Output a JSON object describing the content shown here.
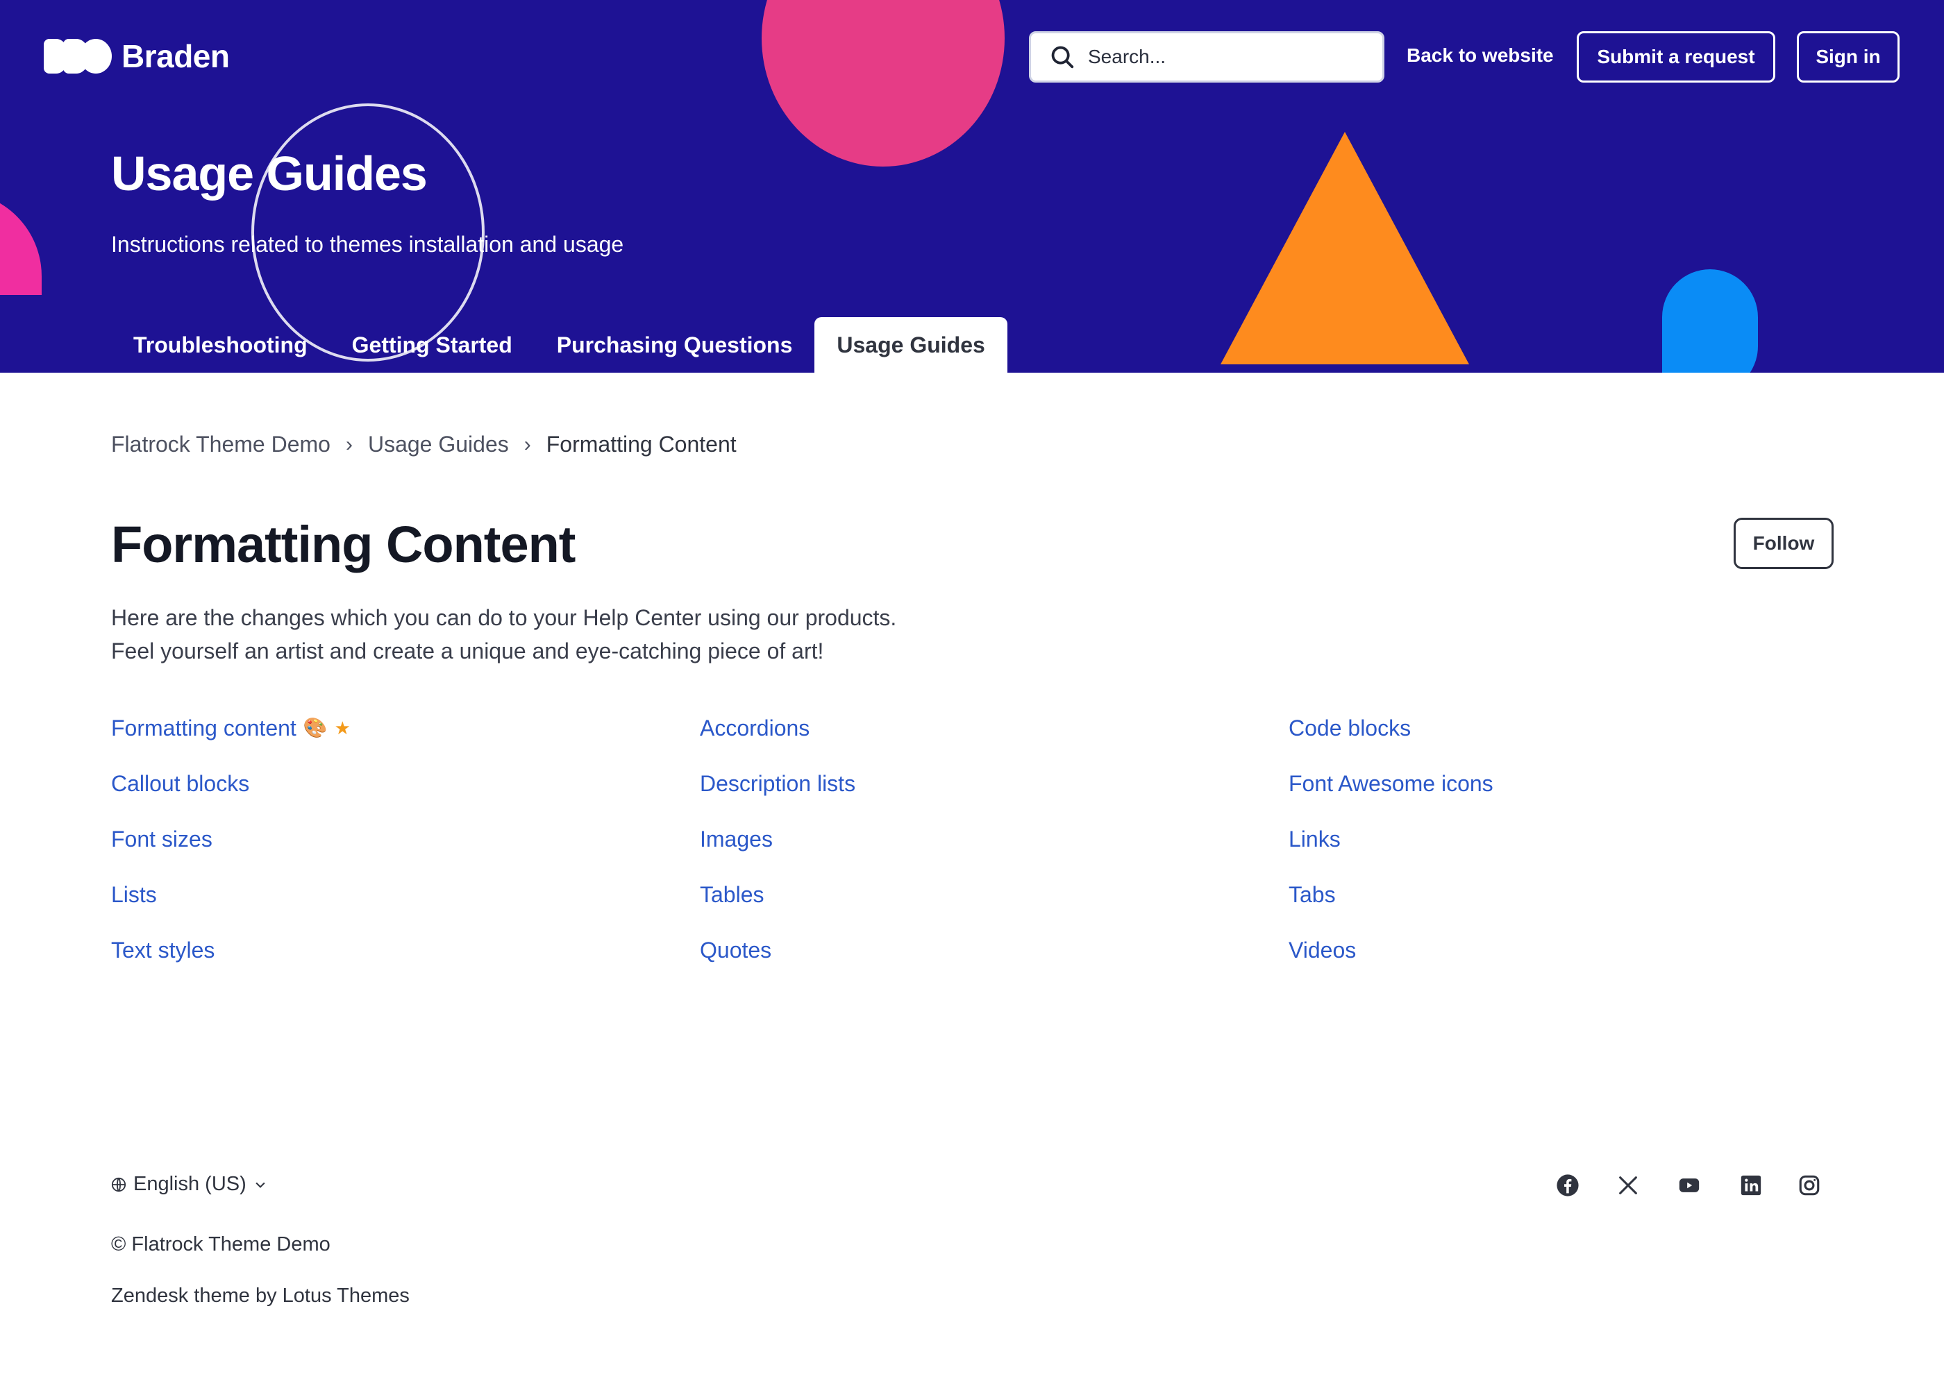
{
  "brand": {
    "name": "Braden"
  },
  "header": {
    "search_placeholder": "Search...",
    "back_to_website": "Back to website",
    "submit_request": "Submit a request",
    "sign_in": "Sign in"
  },
  "hero": {
    "title": "Usage Guides",
    "subtitle": "Instructions related to themes installation and usage",
    "tabs": [
      {
        "label": "Troubleshooting",
        "active": false
      },
      {
        "label": "Getting Started",
        "active": false
      },
      {
        "label": "Purchasing Questions",
        "active": false
      },
      {
        "label": "Usage Guides",
        "active": true
      }
    ],
    "colors": {
      "background": "#1e1294",
      "pink": "#e63c86",
      "orange": "#fe8b1e",
      "blue": "#0a8cf6",
      "magenta": "#f02ea0"
    }
  },
  "breadcrumb": {
    "items": [
      "Flatrock Theme Demo",
      "Usage Guides",
      "Formatting Content"
    ],
    "separator": "›"
  },
  "section": {
    "title": "Formatting Content",
    "follow_label": "Follow",
    "description_line1": "Here are the changes which you can do to your Help Center using our products.",
    "description_line2": "Feel yourself an artist and create a unique and eye-catching piece of art!"
  },
  "articles": [
    {
      "label": "Formatting content",
      "emoji": "🎨",
      "star": "★"
    },
    {
      "label": "Accordions"
    },
    {
      "label": "Code blocks"
    },
    {
      "label": "Callout blocks"
    },
    {
      "label": "Description lists"
    },
    {
      "label": "Font Awesome icons"
    },
    {
      "label": "Font sizes"
    },
    {
      "label": "Images"
    },
    {
      "label": "Links"
    },
    {
      "label": "Lists"
    },
    {
      "label": "Tables"
    },
    {
      "label": "Tabs"
    },
    {
      "label": "Text styles"
    },
    {
      "label": "Quotes"
    },
    {
      "label": "Videos"
    }
  ],
  "footer": {
    "language": "English (US)",
    "copyright": "© Flatrock Theme Demo",
    "credit": "Zendesk theme by Lotus Themes",
    "socials": [
      "facebook-icon",
      "x-icon",
      "youtube-icon",
      "linkedin-icon",
      "instagram-icon"
    ]
  },
  "link_color": "#2b58c9"
}
